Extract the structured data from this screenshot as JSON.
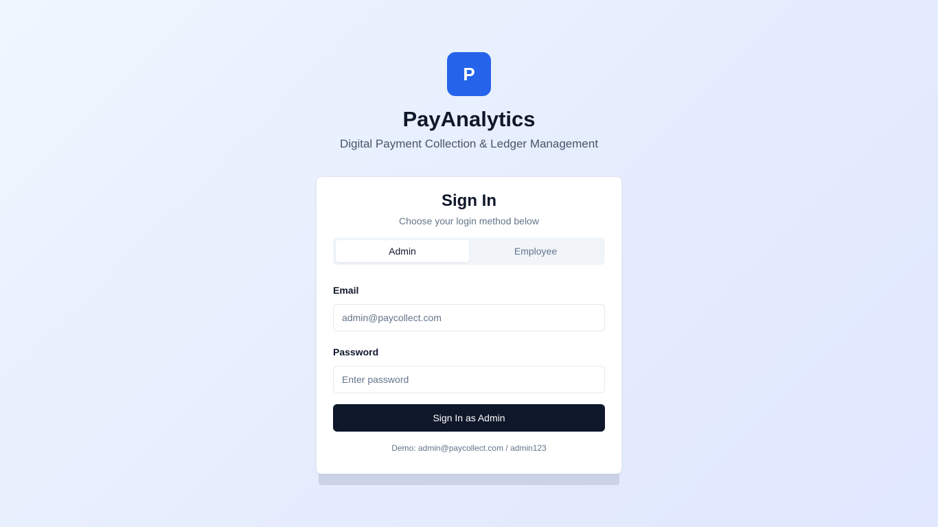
{
  "brand": {
    "logo_letter": "P",
    "title": "PayAnalytics",
    "subtitle": "Digital Payment Collection & Ledger Management"
  },
  "card": {
    "title": "Sign In",
    "subtitle": "Choose your login method below",
    "tabs": [
      {
        "label": "Admin",
        "active": true
      },
      {
        "label": "Employee",
        "active": false
      }
    ],
    "email": {
      "label": "Email",
      "value": "",
      "placeholder": "admin@paycollect.com"
    },
    "password": {
      "label": "Password",
      "value": "",
      "placeholder": "Enter password"
    },
    "submit_label": "Sign In as Admin",
    "demo_text": "Demo: admin@paycollect.com / admin123"
  },
  "colors": {
    "primary": "#2563eb",
    "button_dark": "#0f172a",
    "muted_text": "#64748b"
  }
}
